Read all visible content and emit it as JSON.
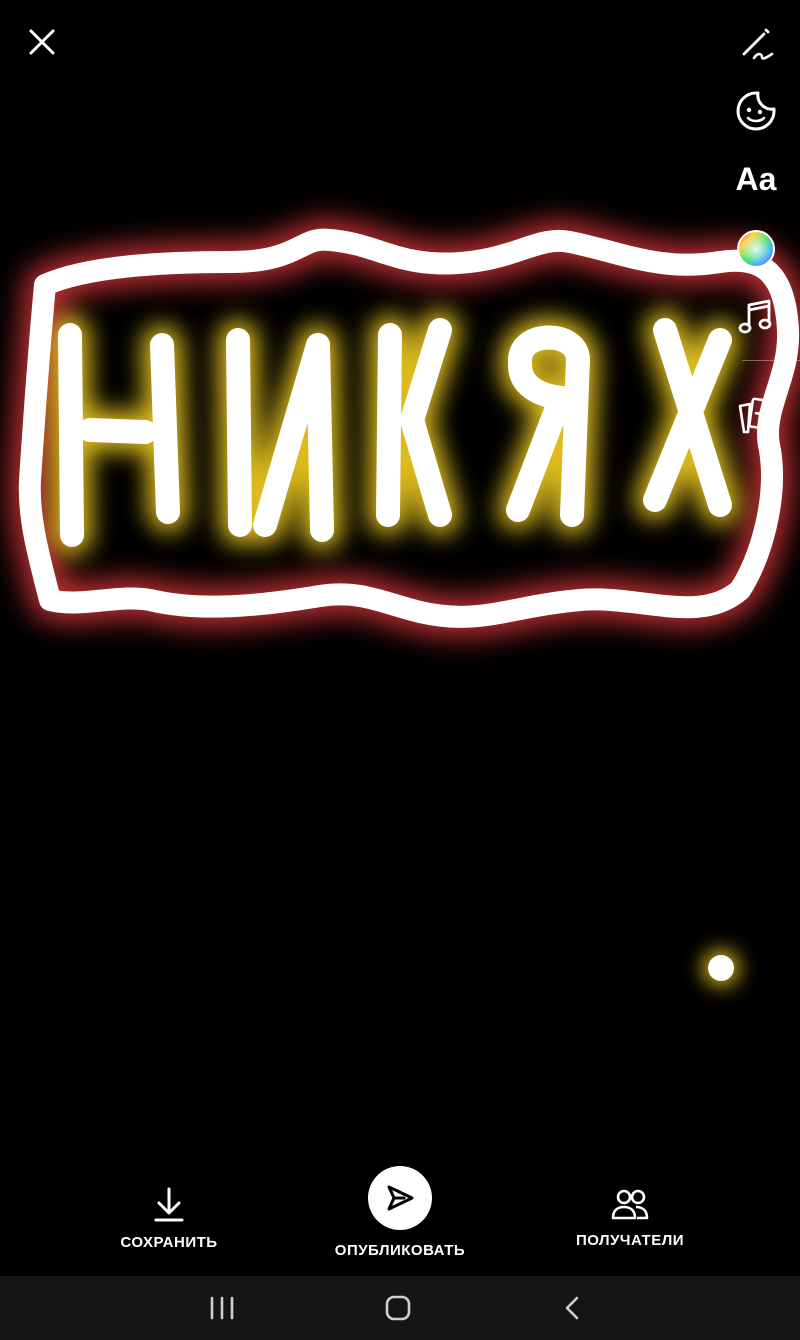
{
  "bottom_bar": {
    "save_label": "СОХРАНИТЬ",
    "publish_label": "ОПУБЛИКОВАТЬ",
    "recipients_label": "ПОЛУЧАТЕЛИ"
  },
  "toolbar": {
    "text_tool_label": "Aa",
    "icons": [
      "draw-icon",
      "sticker-icon",
      "text-icon",
      "color-wheel-icon",
      "music-icon",
      "cards-icon"
    ]
  },
  "close_icon": "close-icon",
  "drawing": {
    "handwritten_text": "НИКЯХ",
    "frame_color": "#ffffff",
    "frame_glow": "#e0383a",
    "letters_glow": "#f5d020",
    "background": "#000000"
  },
  "system_nav": {
    "icons": [
      "recent-apps-icon",
      "home-icon",
      "back-icon"
    ]
  }
}
